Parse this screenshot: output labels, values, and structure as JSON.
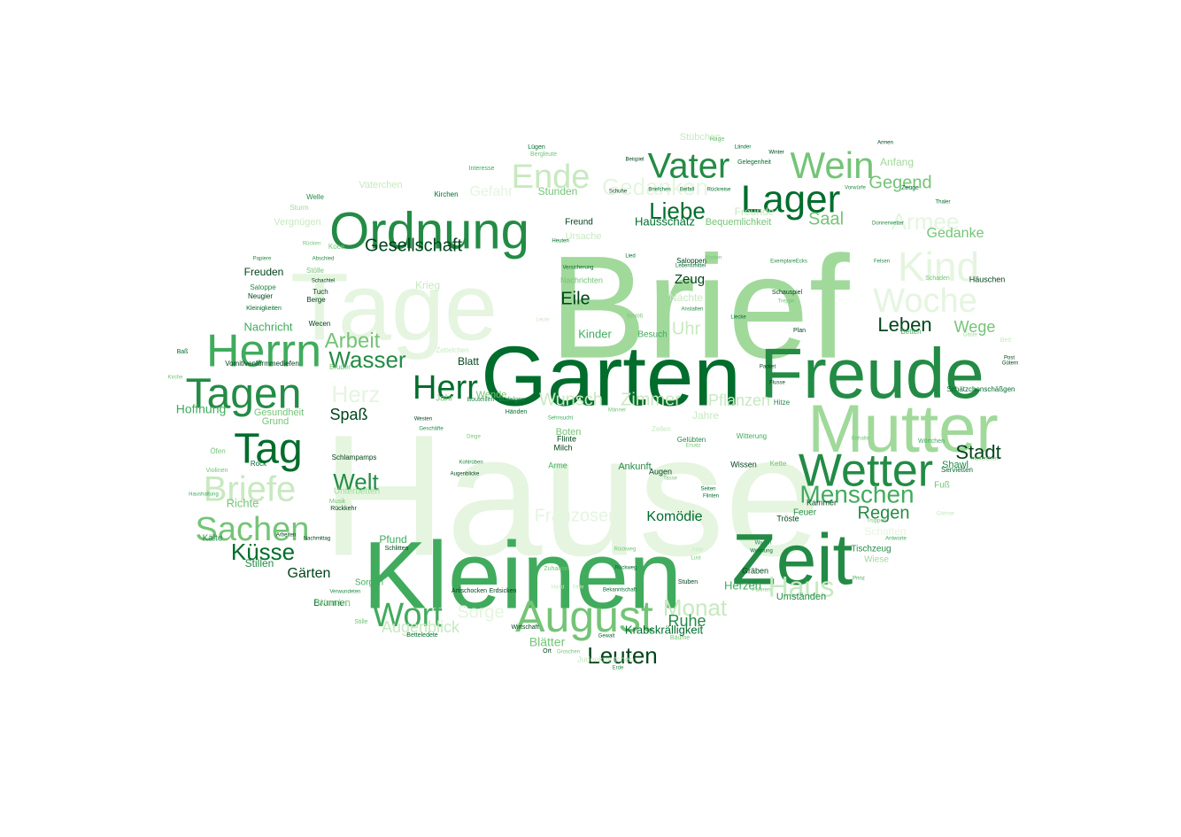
{
  "palette": {
    "lightest": "#e5f5e0",
    "light": "#c7e9c0",
    "mid_light": "#a1d99b",
    "mid": "#74c476",
    "medium": "#41ab5d",
    "dark": "#238b45",
    "darker": "#006d2c",
    "darkest": "#00441b"
  },
  "words": [
    {
      "text": "Hause",
      "tone": "lightest"
    },
    {
      "text": "Brief",
      "tone": "mid_light"
    },
    {
      "text": "Tage",
      "tone": "lightest"
    },
    {
      "text": "Kleinen",
      "tone": "medium"
    },
    {
      "text": "Garten",
      "tone": "darker"
    },
    {
      "text": "Freude",
      "tone": "dark"
    },
    {
      "text": "Mutter",
      "tone": "mid_light"
    },
    {
      "text": "Zeit",
      "tone": "dark"
    },
    {
      "text": "Ordnung",
      "tone": "dark"
    },
    {
      "text": "Lager",
      "tone": "darker"
    },
    {
      "text": "Wetter",
      "tone": "dark"
    },
    {
      "text": "Herrn",
      "tone": "medium"
    },
    {
      "text": "Tagen",
      "tone": "dark"
    },
    {
      "text": "Tag",
      "tone": "darker"
    },
    {
      "text": "August",
      "tone": "mid"
    },
    {
      "text": "Wein",
      "tone": "mid"
    },
    {
      "text": "Vater",
      "tone": "dark"
    },
    {
      "text": "Briefe",
      "tone": "light"
    },
    {
      "text": "Sachen",
      "tone": "mid"
    },
    {
      "text": "Kind",
      "tone": "lightest"
    },
    {
      "text": "Woche",
      "tone": "lightest"
    },
    {
      "text": "Wort",
      "tone": "medium"
    },
    {
      "text": "Ende",
      "tone": "light"
    },
    {
      "text": "Menschen",
      "tone": "medium"
    },
    {
      "text": "Herr",
      "tone": "darker"
    },
    {
      "text": "Haus",
      "tone": "light"
    },
    {
      "text": "Monat",
      "tone": "light"
    },
    {
      "text": "Wasser",
      "tone": "dark"
    },
    {
      "text": "Gedanken",
      "tone": "lightest"
    },
    {
      "text": "Leuten",
      "tone": "darkest"
    },
    {
      "text": "Welt",
      "tone": "dark"
    },
    {
      "text": "Liebe",
      "tone": "darker"
    },
    {
      "text": "Armee",
      "tone": "lightest"
    },
    {
      "text": "Stadt",
      "tone": "darkest"
    },
    {
      "text": "Leben",
      "tone": "darkest"
    },
    {
      "text": "Küsse",
      "tone": "darker"
    },
    {
      "text": "Herz",
      "tone": "lightest"
    },
    {
      "text": "Arbeit",
      "tone": "mid"
    },
    {
      "text": "Regen",
      "tone": "dark"
    },
    {
      "text": "Franzosen",
      "tone": "lightest"
    },
    {
      "text": "Gesellschaft",
      "tone": "darkest"
    },
    {
      "text": "Wunsch",
      "tone": "light"
    },
    {
      "text": "Zimmer",
      "tone": "light"
    },
    {
      "text": "Saal",
      "tone": "mid"
    },
    {
      "text": "Gegend",
      "tone": "mid"
    },
    {
      "text": "Eile",
      "tone": "darkest"
    },
    {
      "text": "Uhr",
      "tone": "light"
    },
    {
      "text": "Spaß",
      "tone": "darkest"
    },
    {
      "text": "Pflanzen",
      "tone": "light"
    },
    {
      "text": "Sorge",
      "tone": "lightest"
    },
    {
      "text": "Augenblick",
      "tone": "light"
    },
    {
      "text": "Wege",
      "tone": "mid"
    },
    {
      "text": "Gedanke",
      "tone": "mid"
    },
    {
      "text": "Ruhe",
      "tone": "dark"
    },
    {
      "text": "Komödie",
      "tone": "darker"
    },
    {
      "text": "Blätter",
      "tone": "mid"
    },
    {
      "text": "Gefahr",
      "tone": "lightest"
    },
    {
      "text": "Gärten",
      "tone": "darkest"
    },
    {
      "text": "Hoffnung",
      "tone": "medium"
    },
    {
      "text": "Herzen",
      "tone": "medium"
    },
    {
      "text": "Richte",
      "tone": "mid"
    },
    {
      "text": "Stillen",
      "tone": "dark"
    },
    {
      "text": "Nachricht",
      "tone": "medium"
    },
    {
      "text": "Stunden",
      "tone": "mid"
    },
    {
      "text": "Anfang",
      "tone": "mid_light"
    },
    {
      "text": "Zeug",
      "tone": "darkest"
    },
    {
      "text": "Kinder",
      "tone": "medium"
    },
    {
      "text": "Jahre",
      "tone": "light"
    },
    {
      "text": "Hausschatz",
      "tone": "darker"
    },
    {
      "text": "Bequemlichkeit",
      "tone": "mid"
    },
    {
      "text": "Krabskrälligkeit",
      "tone": "darker"
    },
    {
      "text": "Freunde",
      "tone": "light"
    },
    {
      "text": "Gesundheit",
      "tone": "mid"
    },
    {
      "text": "Grund",
      "tone": "mid"
    },
    {
      "text": "Pfund",
      "tone": "medium"
    },
    {
      "text": "Brunnen",
      "tone": "darker"
    },
    {
      "text": "Umständen",
      "tone": "dark"
    },
    {
      "text": "Blatt",
      "tone": "darkest"
    },
    {
      "text": "Nächte",
      "tone": "light"
    },
    {
      "text": "Häuschen",
      "tone": "darkest"
    },
    {
      "text": "Stübchen",
      "tone": "light"
    },
    {
      "text": "Krieg",
      "tone": "light"
    },
    {
      "text": "Ursache",
      "tone": "light"
    },
    {
      "text": "Vergnügen",
      "tone": "light"
    },
    {
      "text": "Vaterchen",
      "tone": "light"
    },
    {
      "text": "Ankunft",
      "tone": "dark"
    },
    {
      "text": "Boten",
      "tone": "mid"
    },
    {
      "text": "Shawl",
      "tone": "dark"
    },
    {
      "text": "Fuß",
      "tone": "mid"
    },
    {
      "text": "Unterbetten",
      "tone": "mid_light"
    },
    {
      "text": "Wiese",
      "tone": "mid_light"
    },
    {
      "text": "Tischzeug",
      "tone": "dark"
    },
    {
      "text": "Kälte",
      "tone": "dark"
    },
    {
      "text": "Freuden",
      "tone": "darkest"
    },
    {
      "text": "Kammer",
      "tone": "darkest"
    },
    {
      "text": "Feuer",
      "tone": "dark"
    },
    {
      "text": "Wunden",
      "tone": "mid_light"
    },
    {
      "text": "Sorgen",
      "tone": "medium"
    },
    {
      "text": "Jahr",
      "tone": "mid"
    },
    {
      "text": "Wende",
      "tone": "mid"
    },
    {
      "text": "Besuch",
      "tone": "medium"
    },
    {
      "text": "Nachrichten",
      "tone": "mid"
    },
    {
      "text": "Freund",
      "tone": "darkest"
    },
    {
      "text": "Saloppen",
      "tone": "darkest"
    },
    {
      "text": "Zettelchen",
      "tone": "light"
    },
    {
      "text": "Flinte",
      "tone": "darkest"
    },
    {
      "text": "Milch",
      "tone": "darkest"
    },
    {
      "text": "Arme",
      "tone": "medium"
    },
    {
      "text": "Augen",
      "tone": "darkest"
    },
    {
      "text": "Wissen",
      "tone": "darkest"
    },
    {
      "text": "Kette",
      "tone": "mid"
    },
    {
      "text": "Gräben",
      "tone": "darkest"
    },
    {
      "text": "Tröste",
      "tone": "darkest"
    },
    {
      "text": "Schatten",
      "tone": "lightest"
    },
    {
      "text": "Hitze",
      "tone": "dark"
    },
    {
      "text": "Lügen",
      "tone": "darker"
    },
    {
      "text": "Bergleute",
      "tone": "mid"
    },
    {
      "text": "Interesse",
      "tone": "medium"
    },
    {
      "text": "Kirchen",
      "tone": "darker"
    },
    {
      "text": "Welle",
      "tone": "dark"
    },
    {
      "text": "Sturm",
      "tone": "mid_light"
    },
    {
      "text": "Stölle",
      "tone": "mid"
    },
    {
      "text": "Rock",
      "tone": "darker"
    },
    {
      "text": "Öfen",
      "tone": "mid"
    },
    {
      "text": "Violinen",
      "tone": "mid"
    },
    {
      "text": "Spätzchen",
      "tone": "darker"
    },
    {
      "text": "Kirche",
      "tone": "mid"
    },
    {
      "text": "Baß",
      "tone": "darker"
    },
    {
      "text": "Papiere",
      "tone": "dark"
    },
    {
      "text": "Saloppe",
      "tone": "dark"
    },
    {
      "text": "Neugier",
      "tone": "darkest"
    },
    {
      "text": "Kleinigkeiten",
      "tone": "darker"
    },
    {
      "text": "Berge",
      "tone": "darkest"
    },
    {
      "text": "Tuch",
      "tone": "darkest"
    },
    {
      "text": "Schachtel",
      "tone": "darkest"
    },
    {
      "text": "Abschied",
      "tone": "dark"
    },
    {
      "text": "Koce",
      "tone": "mid"
    },
    {
      "text": "Rücken",
      "tone": "mid"
    },
    {
      "text": "Wecen",
      "tone": "darkest"
    },
    {
      "text": "Vomitivenformmediefen",
      "tone": "darkest"
    },
    {
      "text": "Bruder",
      "tone": "mid"
    },
    {
      "text": "Schlampamps",
      "tone": "darkest"
    },
    {
      "text": "Musik",
      "tone": "mid"
    },
    {
      "text": "Rückkehr",
      "tone": "darkest"
    },
    {
      "text": "Arbeiten",
      "tone": "darkest"
    },
    {
      "text": "Nachmittag",
      "tone": "darkest"
    },
    {
      "text": "Schlitten",
      "tone": "darkest"
    },
    {
      "text": "Verwundeten",
      "tone": "dark"
    },
    {
      "text": "Stille",
      "tone": "mid"
    },
    {
      "text": "Betteledete",
      "tone": "darker"
    },
    {
      "text": "Wirtschaft",
      "tone": "darkest"
    },
    {
      "text": "Ort",
      "tone": "darkest"
    },
    {
      "text": "Erde",
      "tone": "dark"
    },
    {
      "text": "Gewalt",
      "tone": "darker"
    },
    {
      "text": "Stuben",
      "tone": "darkest"
    },
    {
      "text": "Bekanntschaft",
      "tone": "darker"
    },
    {
      "text": "Rückweg",
      "tone": "darker"
    },
    {
      "text": "Artischocken",
      "tone": "darkest"
    },
    {
      "text": "Erdsicken",
      "tone": "darkest"
    },
    {
      "text": "Westen",
      "tone": "darkest"
    },
    {
      "text": "Dinge",
      "tone": "mid"
    },
    {
      "text": "Geschäfte",
      "tone": "dark"
    },
    {
      "text": "Kohlrüben",
      "tone": "dark"
    },
    {
      "text": "Augenblicke",
      "tone": "darkest"
    },
    {
      "text": "Bouteillen",
      "tone": "dark"
    },
    {
      "text": "Budelgen",
      "tone": "dark"
    },
    {
      "text": "Sehnsucht",
      "tone": "medium"
    },
    {
      "text": "Händen",
      "tone": "darker"
    },
    {
      "text": "Männer",
      "tone": "mid"
    },
    {
      "text": "Gelübten",
      "tone": "dark"
    },
    {
      "text": "Ersatz",
      "tone": "mid"
    },
    {
      "text": "Tasse",
      "tone": "mid"
    },
    {
      "text": "Zellen",
      "tone": "light"
    },
    {
      "text": "Seiten",
      "tone": "darker"
    },
    {
      "text": "Flinten",
      "tone": "darker"
    },
    {
      "text": "Witterung",
      "tone": "medium"
    },
    {
      "text": "Wagen",
      "tone": "dark"
    },
    {
      "text": "Wohnung",
      "tone": "darker"
    },
    {
      "text": "Fälle",
      "tone": "light"
    },
    {
      "text": "Lust",
      "tone": "mid"
    },
    {
      "text": "Prinz",
      "tone": "medium"
    },
    {
      "text": "Antworte",
      "tone": "medium"
    },
    {
      "text": "Truppen",
      "tone": "mid"
    },
    {
      "text": "Gärtner",
      "tone": "light"
    },
    {
      "text": "Servietten",
      "tone": "darker"
    },
    {
      "text": "Mütterchen",
      "tone": "mid"
    },
    {
      "text": "Wörtchen",
      "tone": "medium"
    },
    {
      "text": "Behalte",
      "tone": "mid"
    },
    {
      "text": "Schätzchenschäßgen",
      "tone": "darker"
    },
    {
      "text": "Post",
      "tone": "darkest"
    },
    {
      "text": "Gütern",
      "tone": "darkest"
    },
    {
      "text": "Bett",
      "tone": "light"
    },
    {
      "text": "Gäste",
      "tone": "mid_light"
    },
    {
      "text": "Betten",
      "tone": "medium"
    },
    {
      "text": "Packet",
      "tone": "darkest"
    },
    {
      "text": "Flusse",
      "tone": "darkest"
    },
    {
      "text": "Plan",
      "tone": "darkest"
    },
    {
      "text": "Schauspiel",
      "tone": "darkest"
    },
    {
      "text": "Treppe",
      "tone": "mid"
    },
    {
      "text": "Felsen",
      "tone": "dark"
    },
    {
      "text": "ExemplareEcks",
      "tone": "dark"
    },
    {
      "text": "Donnerwetter",
      "tone": "dark"
    },
    {
      "text": "Schaden",
      "tone": "mid"
    },
    {
      "text": "Zeuge",
      "tone": "darker"
    },
    {
      "text": "Vorwürfe",
      "tone": "dark"
    },
    {
      "text": "Winter",
      "tone": "darkest"
    },
    {
      "text": "Länder",
      "tone": "darker"
    },
    {
      "text": "Gelegenheit",
      "tone": "darker"
    },
    {
      "text": "Armen",
      "tone": "darkest"
    },
    {
      "text": "Thaler",
      "tone": "darker"
    },
    {
      "text": "Hage",
      "tone": "mid"
    },
    {
      "text": "Beispiel",
      "tone": "darkest"
    },
    {
      "text": "Briefchen",
      "tone": "darker"
    },
    {
      "text": "Beifall",
      "tone": "darker"
    },
    {
      "text": "Rückreise",
      "tone": "darker"
    },
    {
      "text": "Schuhe",
      "tone": "darkest"
    },
    {
      "text": "Kosten",
      "tone": "mid"
    },
    {
      "text": "Versicherung",
      "tone": "darker"
    },
    {
      "text": "Lebensmittel",
      "tone": "darker"
    },
    {
      "text": "Schlöß",
      "tone": "mid"
    },
    {
      "text": "Anstalten",
      "tone": "dark"
    },
    {
      "text": "Liecke",
      "tone": "darker"
    },
    {
      "text": "Zuhause",
      "tone": "mid"
    },
    {
      "text": "Hand",
      "tone": "light"
    },
    {
      "text": "Stille2",
      "tone": "light"
    },
    {
      "text": "Rückweg2",
      "tone": "mid"
    },
    {
      "text": "Bäume",
      "tone": "mid"
    },
    {
      "text": "Groschen",
      "tone": "mid"
    },
    {
      "text": "Judenkrautchen",
      "tone": "light"
    },
    {
      "text": "Haushaltung",
      "tone": "medium"
    },
    {
      "text": "Heuten",
      "tone": "darker"
    },
    {
      "text": "Lied",
      "tone": "darker"
    },
    {
      "text": "Leute",
      "tone": "light"
    },
    {
      "text": "Fahnen",
      "tone": "mid"
    }
  ]
}
